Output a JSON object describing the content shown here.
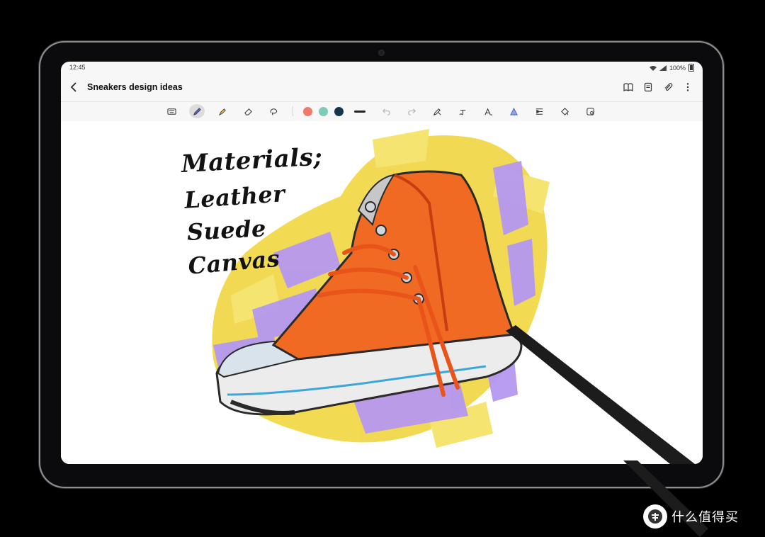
{
  "status_bar": {
    "time": "12:45",
    "battery": "100%"
  },
  "header": {
    "back_icon": "chevron-left-icon",
    "title": "Sneakers design ideas",
    "actions": [
      "book-icon",
      "page-view-icon",
      "attach-icon",
      "more-vert-icon"
    ]
  },
  "toolbar": {
    "tools": [
      "keyboard-icon",
      "pen-icon",
      "highlighter-icon",
      "eraser-icon",
      "lasso-icon"
    ],
    "active_tool": "pen-icon",
    "pen_colors": [
      "#ef7a6c",
      "#7fcbb7",
      "#17354a"
    ],
    "stroke_icon": "stroke-width-icon",
    "history": [
      "undo-icon",
      "redo-icon"
    ],
    "extras": [
      "pen-settings-icon",
      "handwriting-to-text-icon",
      "text-style-icon",
      "shape-icon",
      "insert-icon",
      "fill-icon",
      "image-icon"
    ]
  },
  "note": {
    "handwriting": [
      "Materials;",
      "Leather",
      "Suede",
      "Canvas"
    ],
    "image": "orange-high-top-sneaker-illustration"
  },
  "watermark": {
    "text": "什么值得买",
    "logo": "值"
  }
}
